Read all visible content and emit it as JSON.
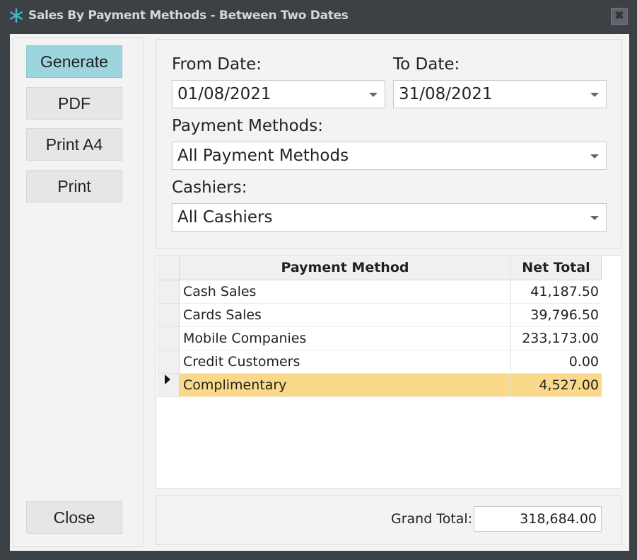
{
  "window": {
    "title": "Sales By Payment Methods - Between Two Dates",
    "close_glyph": "✖"
  },
  "actions": {
    "generate": "Generate",
    "pdf": "PDF",
    "print_a4": "Print A4",
    "print": "Print",
    "close": "Close"
  },
  "filters": {
    "from_label": "From Date:",
    "from_value": "01/08/2021",
    "to_label": "To Date:",
    "to_value": "31/08/2021",
    "payment_label": "Payment Methods:",
    "payment_value": "All Payment Methods",
    "cashiers_label": "Cashiers:",
    "cashiers_value": "All Cashiers"
  },
  "table": {
    "columns": [
      "Payment Method",
      "Net Total"
    ],
    "rows": [
      [
        "Cash Sales",
        "41,187.50"
      ],
      [
        "Cards Sales",
        "39,796.50"
      ],
      [
        "Mobile Companies",
        "233,173.00"
      ],
      [
        "Credit Customers",
        "0.00"
      ],
      [
        "Complimentary",
        "4,527.00"
      ]
    ],
    "selected_row": 4
  },
  "totals": {
    "grand_total_label": "Grand Total:",
    "grand_total_value": "318,684.00"
  },
  "colors": {
    "primary_button": "#9dd5df",
    "selected_row": "#fbd98a",
    "title_bar": "#3c4146"
  },
  "icons": {
    "app": "snowflake-icon",
    "close": "close-icon",
    "dropdown": "chevron-down-icon",
    "row_pointer": "row-pointer-icon"
  }
}
